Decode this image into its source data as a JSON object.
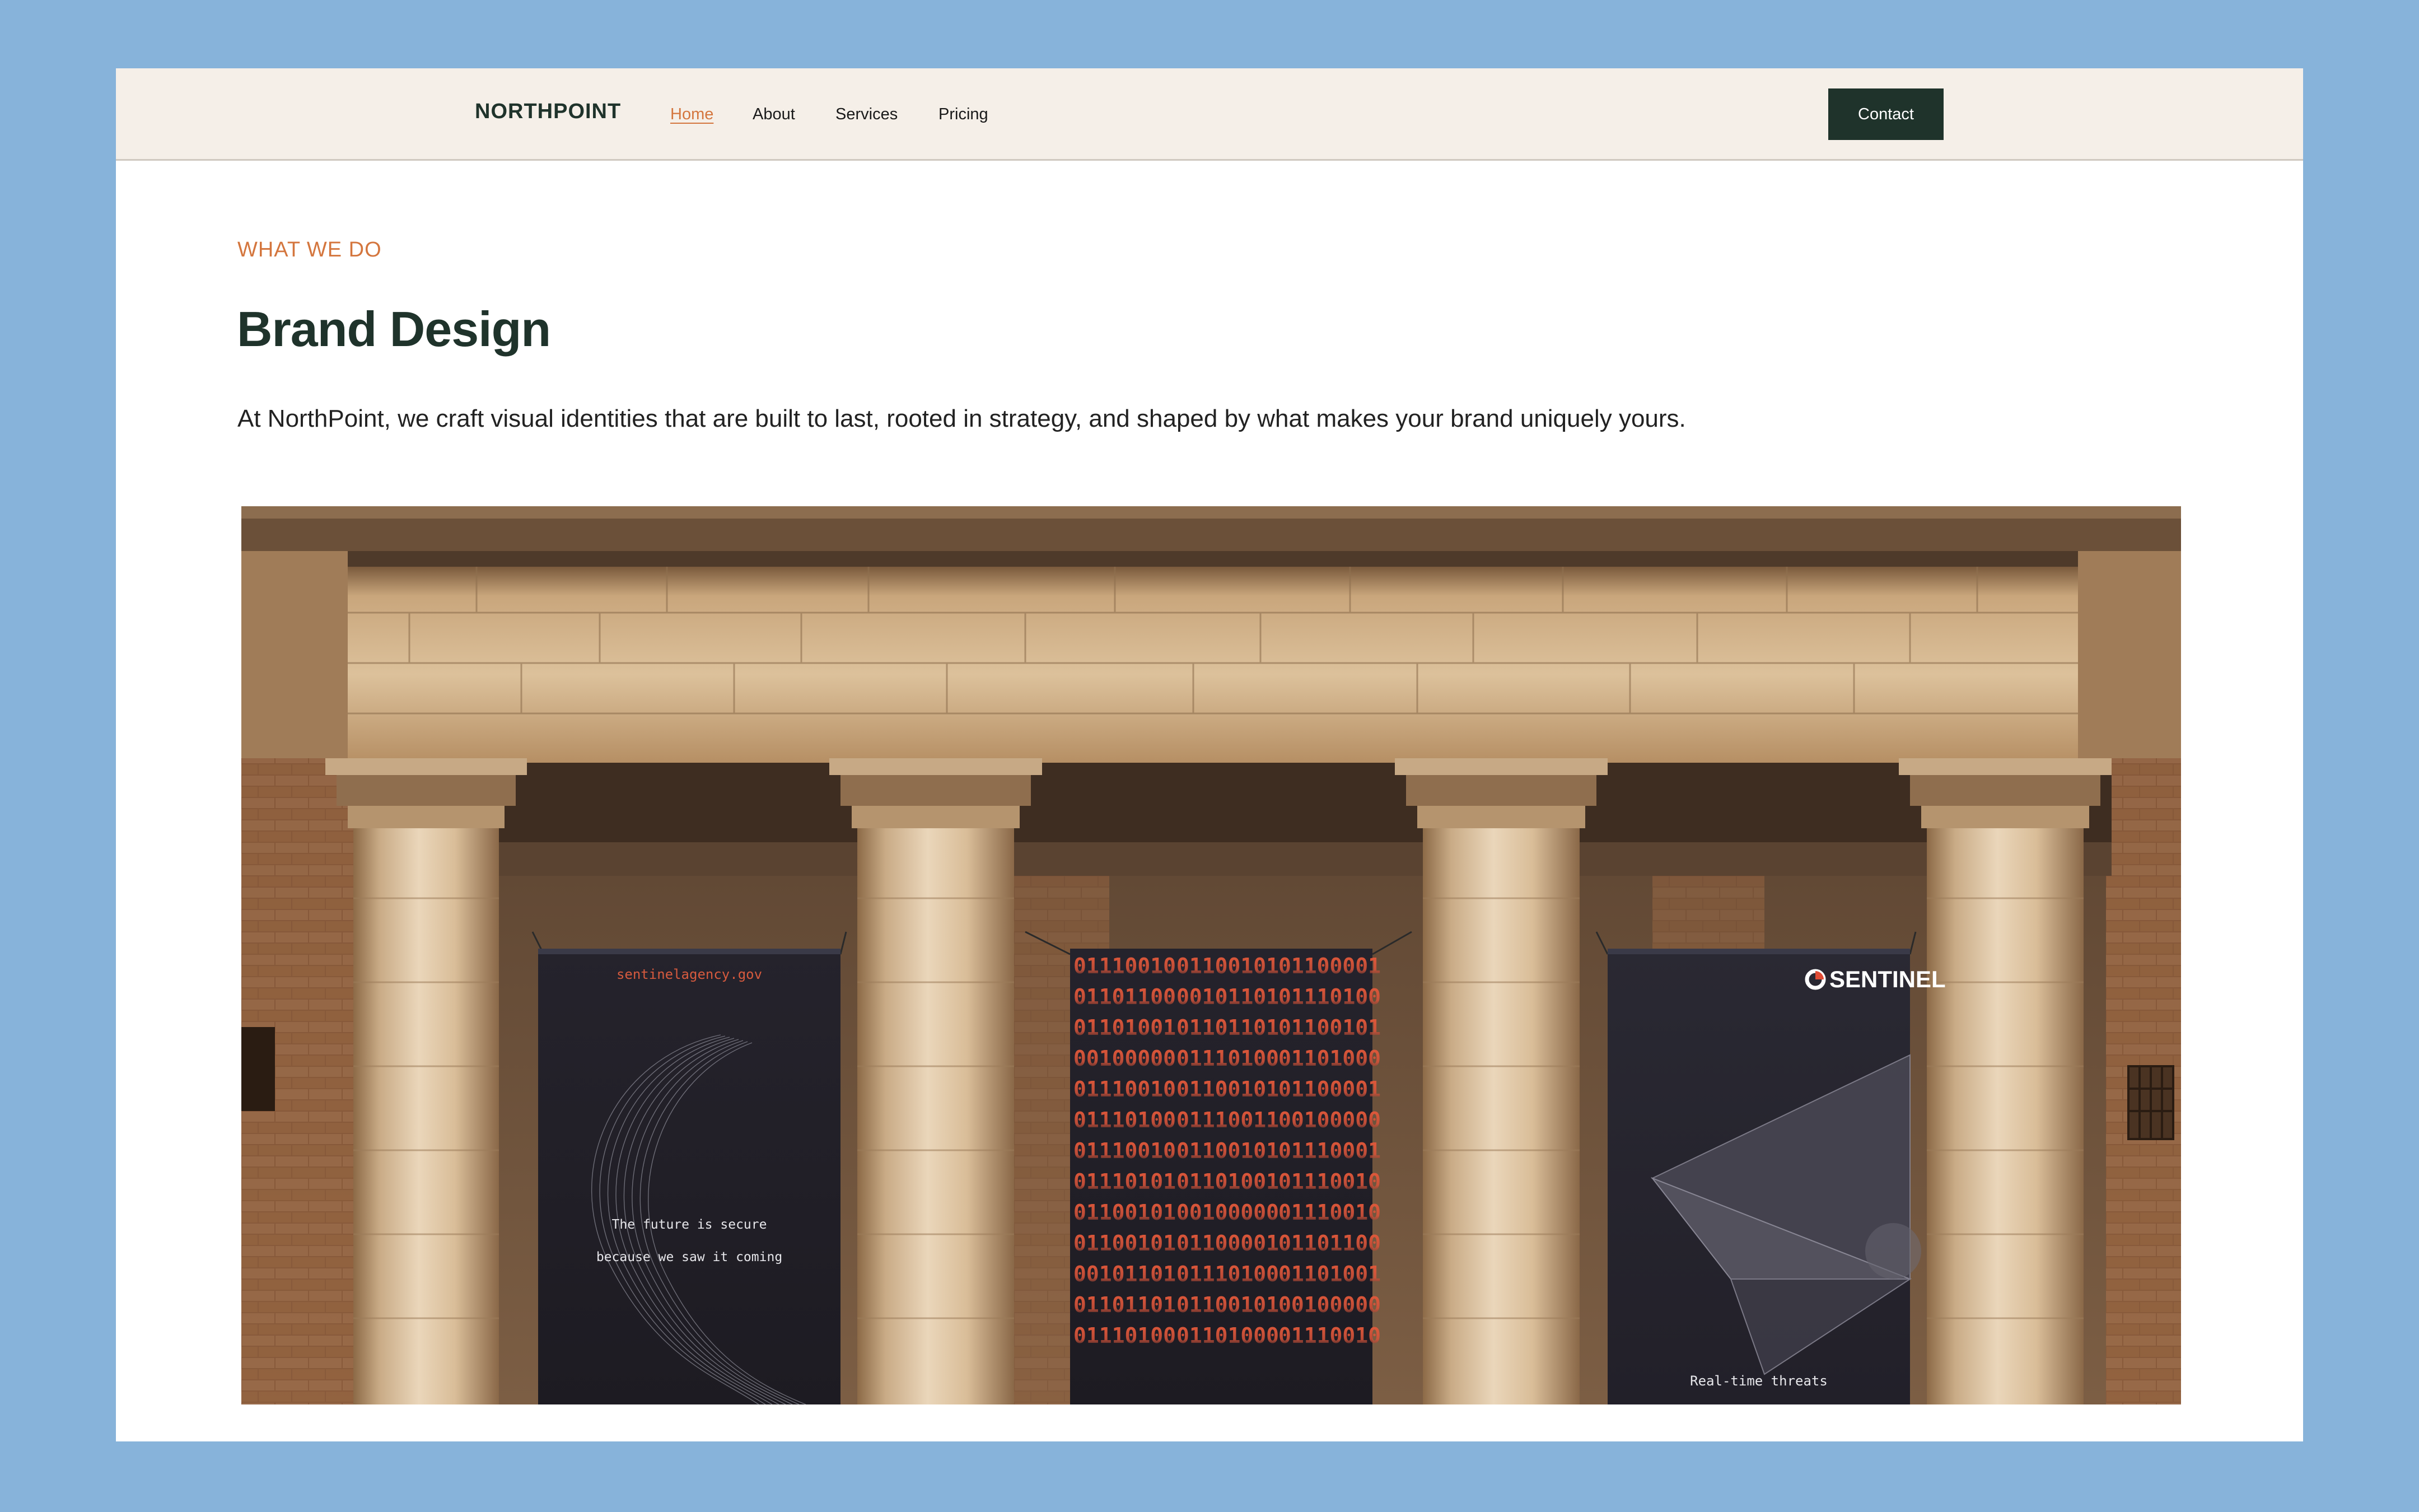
{
  "brand": {
    "name": "NORTHPOINT"
  },
  "nav": {
    "links": [
      {
        "label": "Home",
        "active": true
      },
      {
        "label": "About"
      },
      {
        "label": "Services"
      },
      {
        "label": "Pricing"
      }
    ],
    "cta_label": "Contact"
  },
  "section": {
    "eyebrow": "WHAT WE DO",
    "title": "Brand Design",
    "lead": "At NorthPoint, we craft visual identities that are built to last, rooted in strategy, and shaped by what makes your brand uniquely yours."
  },
  "hero": {
    "banner_left": {
      "url": "sentinelagency.gov",
      "line1": "The future is secure",
      "line2": "because we saw it coming"
    },
    "banner_middle": {
      "binary_rows": [
        [
          "01110010",
          "01100101",
          "01100001"
        ],
        [
          "01101100",
          "00101101",
          "01110100"
        ],
        [
          "01101001",
          "01101101",
          "01100101"
        ],
        [
          "00100000",
          "01110100",
          "01101000"
        ],
        [
          "01110010",
          "01100101",
          "01100001"
        ],
        [
          "01110100",
          "01110011",
          "00100000"
        ],
        [
          "01110010",
          "01100101",
          "01110001"
        ],
        [
          "01110101",
          "01101001",
          "01110010"
        ],
        [
          "01100101",
          "00100000",
          "01110010"
        ],
        [
          "01100101",
          "01100001",
          "01101100"
        ],
        [
          "00101101",
          "01110100",
          "01101001"
        ],
        [
          "01101101",
          "01100101",
          "00100000"
        ],
        [
          "01110100",
          "01101000",
          "01110010"
        ]
      ]
    },
    "banner_right": {
      "brand": "SENTINEL",
      "tagline": "Real-time threats"
    }
  },
  "colors": {
    "background": "#87b3da",
    "nav_bg": "#f5efe8",
    "accent": "#d4763e",
    "dark_green": "#1f332b"
  }
}
